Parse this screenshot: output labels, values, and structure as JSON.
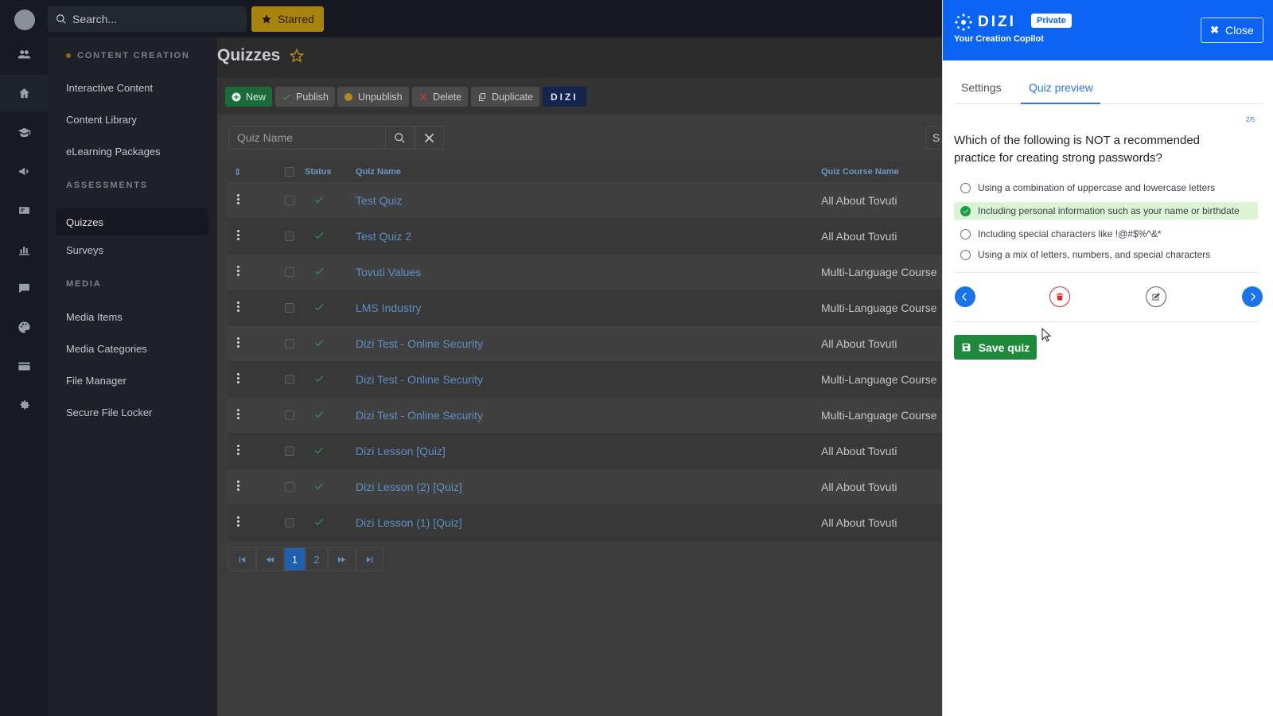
{
  "search": {
    "placeholder": "Search..."
  },
  "topbar": {
    "starred_label": "Starred"
  },
  "rail": {
    "icons": [
      "app-logo",
      "users-icon",
      "home-icon",
      "graduation-icon",
      "megaphone-icon",
      "certificate-icon",
      "chart-icon",
      "chat-icon",
      "palette-icon",
      "card-icon",
      "gear-icon"
    ]
  },
  "sidebar": {
    "sections": [
      {
        "title": "CONTENT CREATION",
        "items": [
          "Interactive Content",
          "Content Library",
          "eLearning Packages"
        ]
      },
      {
        "title": "ASSESSMENTS",
        "items": [
          "Quizzes",
          "Surveys"
        ]
      },
      {
        "title": "MEDIA",
        "items": [
          "Media Items",
          "Media Categories",
          "File Manager",
          "Secure File Locker"
        ]
      }
    ],
    "active": "Quizzes"
  },
  "main": {
    "title": "Quizzes",
    "toolbar": {
      "new": "New",
      "publish": "Publish",
      "unpublish": "Unpublish",
      "delete": "Delete",
      "duplicate": "Duplicate",
      "dizi": "DIZI"
    },
    "filter": {
      "placeholder": "Quiz Name",
      "right_clip": "S"
    },
    "columns": {
      "status": "Status",
      "name": "Quiz Name",
      "course": "Quiz Course Name"
    },
    "rows": [
      {
        "name": "Test Quiz",
        "course": "All About Tovuti"
      },
      {
        "name": "Test Quiz 2",
        "course": "All About Tovuti"
      },
      {
        "name": "Tovuti Values",
        "course": "Multi-Language Course"
      },
      {
        "name": "LMS Industry",
        "course": "Multi-Language Course"
      },
      {
        "name": "Dizi Test - Online Security",
        "course": "All About Tovuti"
      },
      {
        "name": "Dizi Test - Online Security",
        "course": "Multi-Language Course"
      },
      {
        "name": "Dizi Test - Online Security",
        "course": "Multi-Language Course"
      },
      {
        "name": "Dizi Lesson [Quiz]",
        "course": "All About Tovuti"
      },
      {
        "name": "Dizi Lesson (2) [Quiz]",
        "course": "All About Tovuti"
      },
      {
        "name": "Dizi Lesson (1) [Quiz]",
        "course": "All About Tovuti"
      }
    ],
    "pagination": {
      "pages": [
        "1",
        "2"
      ],
      "current": "1"
    }
  },
  "panel": {
    "brand": "DIZI",
    "badge": "Private",
    "tagline": "Your Creation Copilot",
    "close_label": "Close",
    "tabs": [
      "Settings",
      "Quiz preview"
    ],
    "active_tab": "Quiz preview",
    "counter": "2/5",
    "question": "Which of the following is NOT a recommended practice for creating strong passwords?",
    "options": [
      {
        "text": "Using a combination of uppercase and lowercase letters",
        "correct": false
      },
      {
        "text": "Including personal information such as your name or birthdate",
        "correct": true
      },
      {
        "text": "Including special characters like !@#$%^&*",
        "correct": false
      },
      {
        "text": "Using a mix of letters, numbers, and special characters",
        "correct": false
      }
    ],
    "save_label": "Save quiz"
  },
  "colors": {
    "accent": "#0b63f3",
    "success": "#1f8a3c",
    "danger": "#c9303a",
    "starred": "#a88310"
  }
}
